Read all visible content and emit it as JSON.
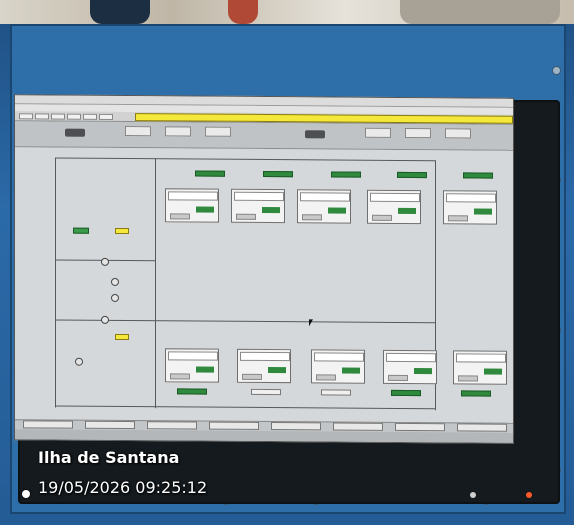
{
  "photo": {
    "caption": {
      "location": "Ilha de Santana",
      "timestamp": "19/05/2026 09:25:12"
    }
  },
  "colors": {
    "cabinet": "#2e6faa",
    "bezel": "#141a1e",
    "screen": "#c9ccce",
    "alarm_bar": "#f4e83a",
    "status_green": "#2f8a3e"
  },
  "icons": [
    "location-pin-icon",
    "cursor-icon"
  ]
}
